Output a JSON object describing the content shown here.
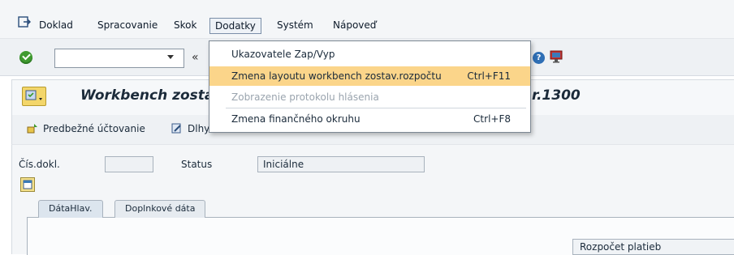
{
  "menubar": {
    "items": [
      {
        "label": "Doklad"
      },
      {
        "label": "Spracovanie"
      },
      {
        "label": "Skok"
      },
      {
        "label": "Dodatky"
      },
      {
        "label": "Systém"
      },
      {
        "label": "Nápoveď"
      }
    ]
  },
  "toolbar": {
    "command_value": "",
    "back_glyph": "«",
    "help_glyph": "?"
  },
  "title": {
    "text": "Workbench zosta",
    "suffix": "r.1300"
  },
  "app_toolbar": {
    "buttons": [
      {
        "label": "Predbežné účtovanie"
      },
      {
        "label": "Dlhy"
      }
    ]
  },
  "form": {
    "doc_label": "Čís.dokl.",
    "doc_value": "",
    "status_label": "Status",
    "status_value": "Iniciálne"
  },
  "tabs": [
    {
      "label": "DátaHlav."
    },
    {
      "label": "Doplnkové dáta"
    }
  ],
  "panel": {
    "rozpocet_label": "Rozpočet platieb"
  },
  "dropdown": {
    "items": [
      {
        "label": "Ukazovatele Zap/Vyp",
        "accel": "",
        "state": "normal"
      },
      {
        "label": "Zmena layoutu workbench zostav.rozpočtu",
        "accel": "Ctrl+F11",
        "state": "highlight"
      },
      {
        "label": "Zobrazenie protokolu hlásenia",
        "accel": "",
        "state": "disabled"
      },
      {
        "label": "Zmena finančného okruhu",
        "accel": "Ctrl+F8",
        "state": "normal"
      }
    ]
  },
  "colors": {
    "highlight": "#fbd58a",
    "accent_green": "#3f9a2f",
    "menubar_bg": "#f4f6f8"
  }
}
